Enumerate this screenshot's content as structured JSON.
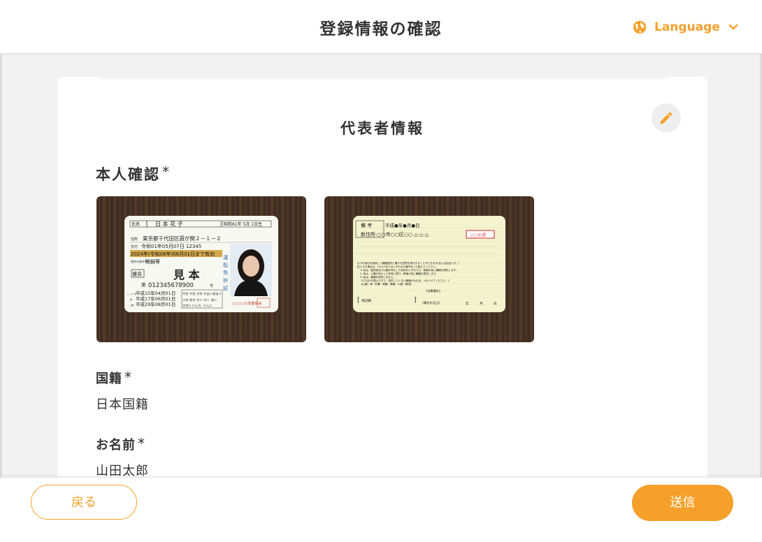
{
  "header": {
    "title": "登録情報の確認",
    "language_label": "Language",
    "globe_icon": "globe-icon",
    "chevron_icon": "chevron-down-icon"
  },
  "section": {
    "title": "代表者情報",
    "edit_icon": "pencil-icon"
  },
  "identity": {
    "heading": "本人確認",
    "required_mark": "*",
    "front_card": {
      "name_label": "氏名",
      "name": "日 本 花 子",
      "birth": "昭和61年 5月 1日生",
      "address_label": "住所",
      "address": "東京都千代田区霞が関２－１－２",
      "issue_label": "交付",
      "issue": "令和01年05月07日 12345",
      "validity": "2024年(令和06年)06月01日まで有効",
      "condition_label": "免許の条件等",
      "condition": "眼鏡等",
      "excellent": "優良",
      "sample": "見 本",
      "number_label": "第",
      "number": "012345678900",
      "number_suffix": "号",
      "vertical_title": "運転免許証",
      "dates": [
        "平成15年04月01日",
        "平成17年06月01日",
        "平成29年08月01日"
      ],
      "issuer": "○○○○公安委員会",
      "date_labels": [
        "二・小・原",
        "他",
        "二種"
      ],
      "category_cells": [
        "中型",
        "中型",
        "大特",
        "大自二",
        "普自二",
        "小特",
        "原付",
        "大二",
        "中二",
        "普二",
        "大特二",
        "けん引",
        "けん二"
      ]
    },
    "back_card": {
      "remarks_label": "備 考",
      "remarks_date": "平成●年●月●日",
      "new_address": "新住所:○○市○○区○○ △-△-△",
      "stamp": "○○公安",
      "notes": [
        "以下の部分を使用して臓器提供に関する意思を表示することができます(記入は自由です。)",
        "記入する場合は、1から3までのいずれかの番号を○で囲んでください。",
        "1. 私は、脳死後及び心臓が停止した死後のいずれでも、移植の為に臓器を提供します。",
        "2. 私は、心臓が停止した死後に限り、移植の為に臓器を提供します。",
        "3. 私は、臓器を提供しません。",
        "《1又は2を選んだ方で、提供したくない臓器があれば、×をつけてください。》",
        "【心臓・肺・肝臓・腎臓・膵臓・小腸・眼球】"
      ],
      "special_label": "特記欄：",
      "signature_label": "《自筆署名》",
      "signature_date_label": "《署名年月日》",
      "date_fields": [
        "年",
        "月",
        "日"
      ]
    }
  },
  "nationality": {
    "label": "国籍",
    "required_mark": "*",
    "value": "日本国籍"
  },
  "full_name": {
    "label": "お名前",
    "required_mark": "*",
    "value": "山田太郎"
  },
  "footer": {
    "back_label": "戻る",
    "submit_label": "送信"
  },
  "colors": {
    "accent": "#f5a02b",
    "background": "#f2f2f2",
    "card": "#ffffff",
    "text": "#333333"
  }
}
